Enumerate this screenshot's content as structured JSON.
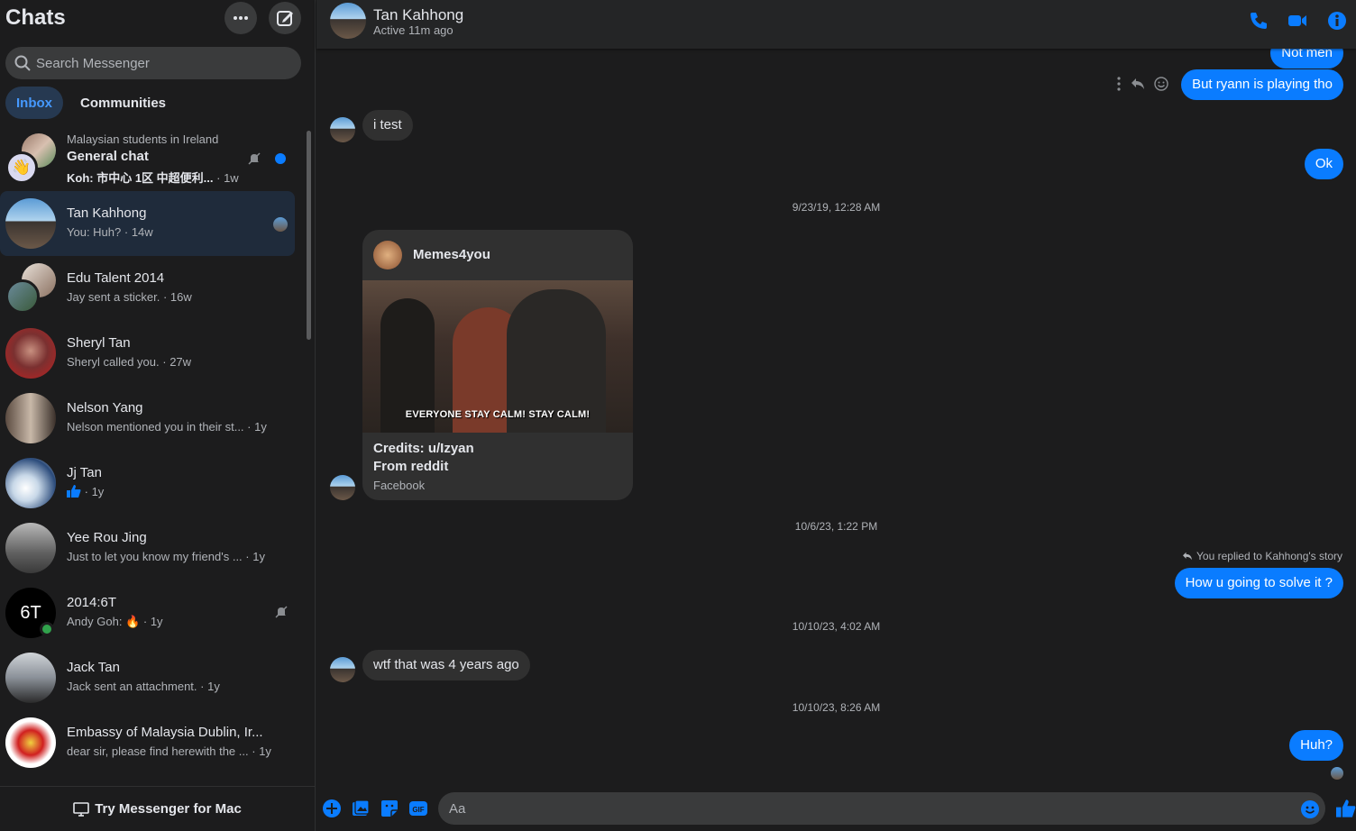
{
  "sidebar": {
    "title": "Chats",
    "search_placeholder": "Search Messenger",
    "tabs": [
      {
        "label": "Inbox",
        "active": true
      },
      {
        "label": "Communities",
        "active": false
      }
    ],
    "conversations": [
      {
        "group": "Malaysian students in Ireland",
        "name": "General chat",
        "preview": "Koh: 市中心 1区 中超便利...",
        "time": "1w",
        "unread": true,
        "muted": true
      },
      {
        "name": "Tan Kahhong",
        "preview": "You: Huh?",
        "time": "14w",
        "selected": true,
        "seen": true
      },
      {
        "name": "Edu Talent 2014",
        "preview": "Jay sent a sticker.",
        "time": "16w"
      },
      {
        "name": "Sheryl Tan",
        "preview": "Sheryl called you.",
        "time": "27w"
      },
      {
        "name": "Nelson Yang",
        "preview": "Nelson mentioned you in their st...",
        "time": "1y"
      },
      {
        "name": "Jj Tan",
        "preview": "",
        "preview_icon": "thumbs-up-icon",
        "time": "1y"
      },
      {
        "name": "Yee Rou Jing",
        "preview": "Just to let you know my friend's ...",
        "time": "1y"
      },
      {
        "name": "2014:6T",
        "avatar_text": "6T",
        "preview": "Andy Goh:",
        "preview_icon": "fire-icon",
        "time": "1y",
        "muted": true,
        "online": true
      },
      {
        "name": "Jack Tan",
        "preview": "Jack sent an attachment.",
        "time": "1y"
      },
      {
        "name": "Embassy of Malaysia Dublin, Ir...",
        "preview": "dear sir, please find herewith the ...",
        "time": "1y"
      }
    ],
    "footer": "Try Messenger for Mac"
  },
  "header": {
    "name": "Tan Kahhong",
    "status": "Active 11m ago",
    "icons": [
      "phone-icon",
      "video-icon",
      "info-icon"
    ]
  },
  "messages": {
    "partial_top": "Not men",
    "m1": "But ryann is playing tho",
    "m2": "i test",
    "m3": "Ok",
    "ts1": "9/23/19, 12:28 AM",
    "card": {
      "page": "Memes4you",
      "image_caption": "EVERYONE STAY CALM! STAY CALM!",
      "line1": "Credits: u/Izyan",
      "line2": "From reddit",
      "source": "Facebook"
    },
    "ts2": "10/6/23, 1:22 PM",
    "reply_note": "You replied to Kahhong's story",
    "m4": "How u going to solve it ?",
    "ts3": "10/10/23, 4:02 AM",
    "m5": "wtf that was 4 years ago",
    "ts4": "10/10/23, 8:26 AM",
    "m6": "Huh?"
  },
  "composer": {
    "placeholder": "Aa"
  },
  "colors": {
    "accent": "#0a7cff",
    "background": "#1c1c1d",
    "bubble_in": "#303030"
  }
}
